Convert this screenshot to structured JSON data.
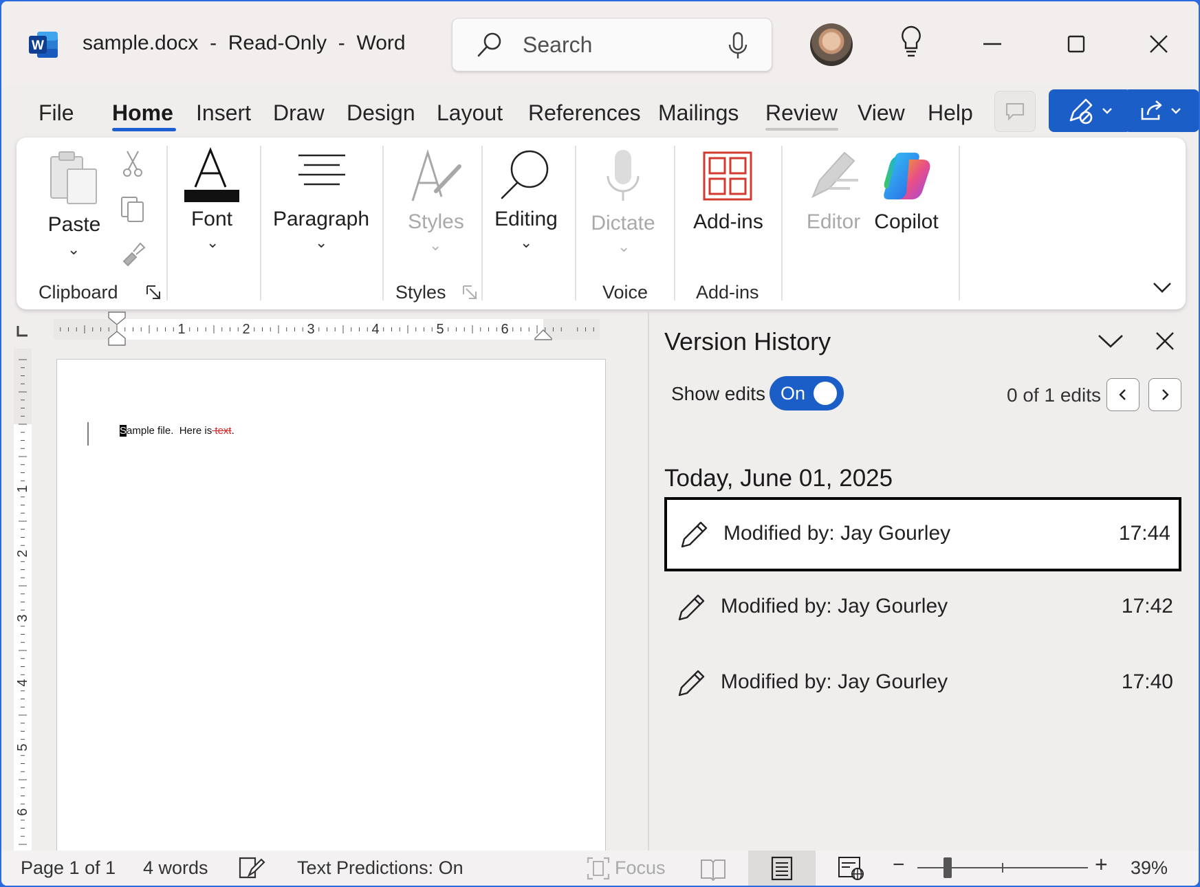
{
  "titlebar": {
    "app_letter": "W",
    "doc_title": "sample.docx  -  Read-Only  -  Word",
    "search_placeholder": "Search"
  },
  "menu": {
    "tabs": [
      "File",
      "Home",
      "Insert",
      "Draw",
      "Design",
      "Layout",
      "References",
      "Mailings",
      "Review",
      "View",
      "Help"
    ],
    "active_tab": "Home"
  },
  "ribbon": {
    "paste": "Paste",
    "font": "Font",
    "paragraph": "Paragraph",
    "styles": "Styles",
    "editing": "Editing",
    "dictate": "Dictate",
    "addins": "Add-ins",
    "editor": "Editor",
    "copilot": "Copilot",
    "groups": {
      "clipboard": "Clipboard",
      "styles": "Styles",
      "voice": "Voice",
      "addins": "Add-ins"
    }
  },
  "ruler": {
    "h_numbers": [
      "1",
      "2",
      "3",
      "4",
      "5",
      "6"
    ],
    "v_numbers": [
      "1",
      "2",
      "3",
      "4",
      "5",
      "6"
    ]
  },
  "document": {
    "caret_char": "S",
    "text_before": "ample file.  Here is",
    "deleted_text": " text",
    "text_after": "."
  },
  "version_history": {
    "title": "Version History",
    "show_edits_label": "Show edits",
    "toggle_state": "On",
    "edits_count": "0 of 1 edits",
    "date_header": "Today, June 01, 2025",
    "versions": [
      {
        "label": "Modified by: Jay Gourley",
        "time": "17:44"
      },
      {
        "label": "Modified by: Jay Gourley",
        "time": "17:42"
      },
      {
        "label": "Modified by: Jay Gourley",
        "time": "17:40"
      }
    ]
  },
  "statusbar": {
    "page": "Page 1 of 1",
    "words": "4 words",
    "text_predictions": "Text Predictions: On",
    "focus": "Focus",
    "zoom": "39%"
  },
  "colors": {
    "accent": "#1c5ec7",
    "deleted_text": "#dd2222",
    "addins_icon": "#d13b2f"
  }
}
